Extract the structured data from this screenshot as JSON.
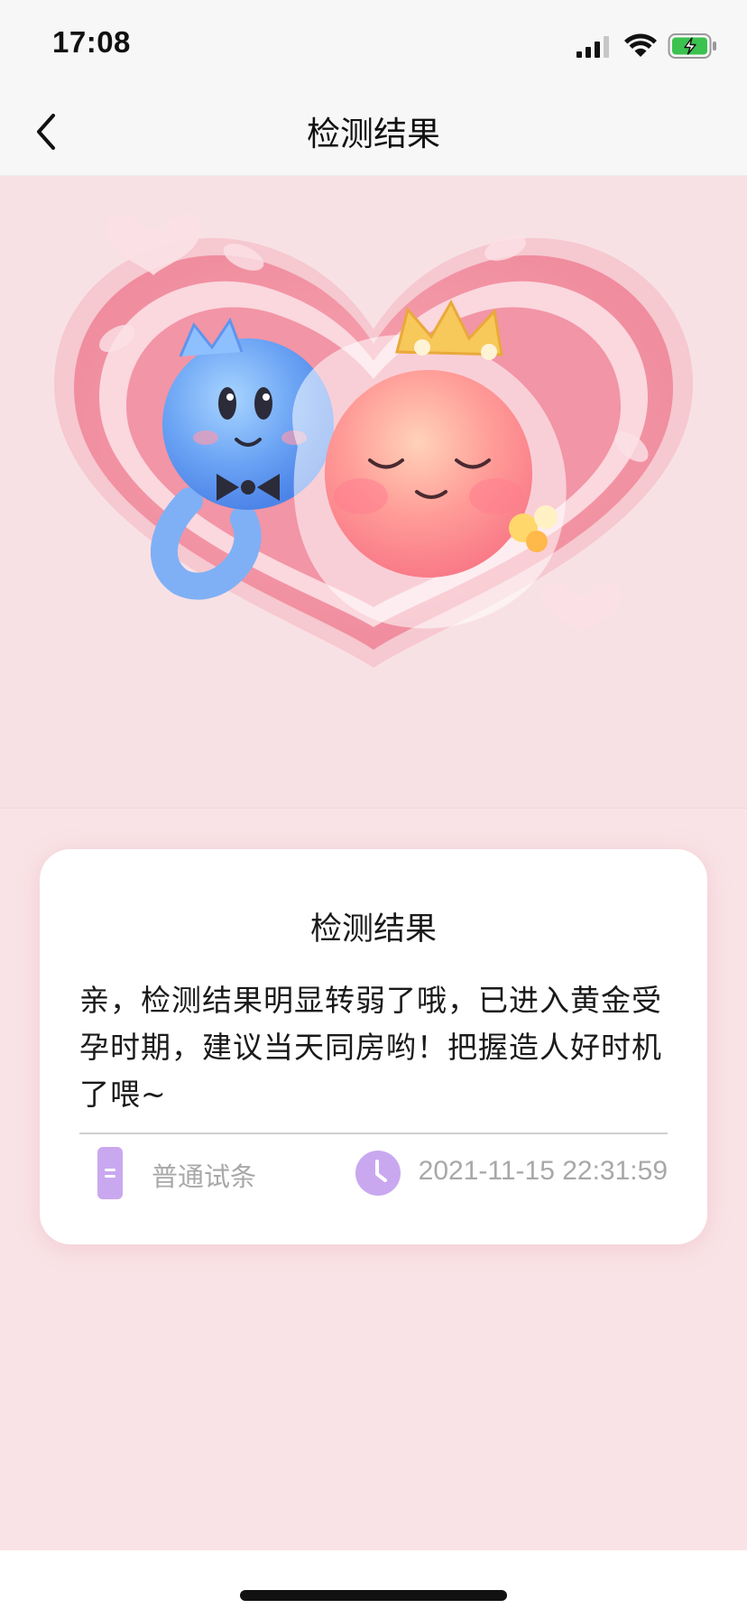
{
  "status_bar": {
    "time": "17:08"
  },
  "nav": {
    "title": "检测结果"
  },
  "result": {
    "title": "检测结果",
    "message": "亲，检测结果明显转弱了哦，已进入黄金受孕时期，建议当天同房哟！把握造人好时机了喂~",
    "strip_type": "普通试条",
    "test_time": "2021-11-15 22:31:59"
  },
  "colors": {
    "background_pink": "#f9e3e6",
    "accent_purple": "#c9a8f0",
    "card": "#ffffff"
  },
  "icons": {
    "back": "chevron-left-icon",
    "strip": "test-strip-icon",
    "clock": "clock-icon"
  }
}
